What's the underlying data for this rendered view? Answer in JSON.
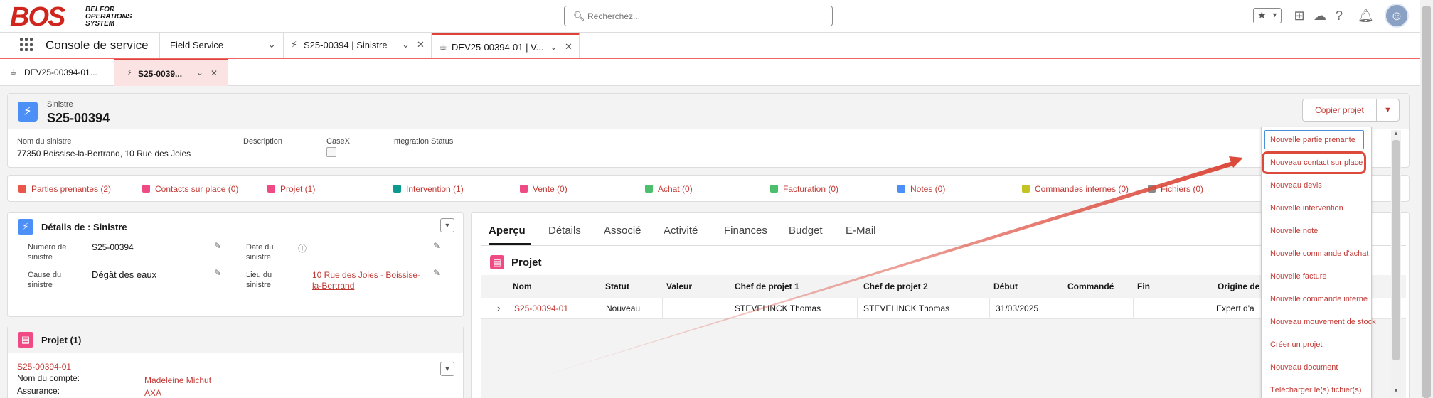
{
  "logo": {
    "big": "BOS",
    "line1": "BELFOR",
    "line2": "OPERATIONS",
    "line3": "SYSTEM"
  },
  "search": {
    "placeholder": "Recherchez..."
  },
  "header_icons": {
    "favorites": "star-icon",
    "dropdown": "chevron-down-icon",
    "add": "plus-icon",
    "trailhead": "trailhead-icon",
    "help": "?",
    "notifications": "bell-icon",
    "avatar": "user-avatar"
  },
  "nav": {
    "app_name": "Console de service",
    "selector": "Field Service",
    "tabs": [
      {
        "label": "S25-00394 | Sinistre"
      },
      {
        "label": "DEV25-00394-01 | V..."
      }
    ]
  },
  "subtabs": [
    {
      "label": "DEV25-00394-01..."
    },
    {
      "label": "S25-0039..."
    }
  ],
  "record": {
    "type": "Sinistre",
    "name": "S25-00394",
    "fields": {
      "nom_label": "Nom du sinistre",
      "nom_value": "77350 Boissise-la-Bertrand, 10 Rue des Joies",
      "description_label": "Description",
      "casex_label": "CaseX",
      "integration_label": "Integration Status"
    },
    "copy_button": "Copier projet"
  },
  "related": [
    {
      "label": "Parties prenantes (2)",
      "color": "#e8574a"
    },
    {
      "label": "Contacts sur place (0)",
      "color": "#f04a84"
    },
    {
      "label": "Projet (1)",
      "color": "#f04a84"
    },
    {
      "label": "Intervention (1)",
      "color": "#0b9a8d"
    },
    {
      "label": "Vente (0)",
      "color": "#f04a84"
    },
    {
      "label": "Achat (0)",
      "color": "#4bbf6b"
    },
    {
      "label": "Facturation (0)",
      "color": "#4bbf6b"
    },
    {
      "label": "Notes (0)",
      "color": "#4c8ff6"
    },
    {
      "label": "Commandes internes (0)",
      "color": "#c5c224"
    },
    {
      "label": "Fichiers (0)",
      "color": "#888888"
    }
  ],
  "detail": {
    "title": "Détails de : Sinistre",
    "numero_label": "Numéro de sinistre",
    "numero_value": "S25-00394",
    "date_label": "Date du sinistre",
    "cause_label": "Cause du sinistre",
    "cause_value": "Dégât des eaux",
    "lieu_label": "Lieu du sinistre",
    "lieu_value": "10 Rue des Joies - Boissise-la-Bertrand"
  },
  "projet_card": {
    "title": "Projet (1)",
    "record_link": "S25-00394-01",
    "compte_label": "Nom du compte:",
    "compte_value": "Madeleine Michut",
    "assurance_label": "Assurance:",
    "assurance_value": "AXA"
  },
  "main_tabs": [
    "Aperçu",
    "Détails",
    "Associé",
    "Activité",
    "Finances",
    "Budget",
    "E-Mail"
  ],
  "projects_table": {
    "title": "Projet",
    "columns": [
      "Nom",
      "Statut",
      "Valeur",
      "Chef de projet 1",
      "Chef de projet 2",
      "Début",
      "Commandé",
      "Fin",
      "Origine de"
    ],
    "row": {
      "nom": "S25-00394-01",
      "statut": "Nouveau",
      "valeur": "",
      "chef1": "STEVELINCK Thomas",
      "chef2": "STEVELINCK Thomas",
      "debut": "31/03/2025",
      "commande": "",
      "fin": "",
      "origine": "Expert d'a"
    }
  },
  "menu_items": [
    "Nouvelle partie prenante",
    "Nouveau contact sur place",
    "Nouveau devis",
    "Nouvelle intervention",
    "Nouvelle note",
    "Nouvelle commande d'achat",
    "Nouvelle facture",
    "Nouvelle commande interne",
    "Nouveau mouvement de stock",
    "Créer un projet",
    "Nouveau document",
    "Télécharger le(s) fichier(s)"
  ],
  "colors": {
    "accent": "#c23934",
    "brand": "#d0251c",
    "highlight": "#dc4a3c"
  }
}
